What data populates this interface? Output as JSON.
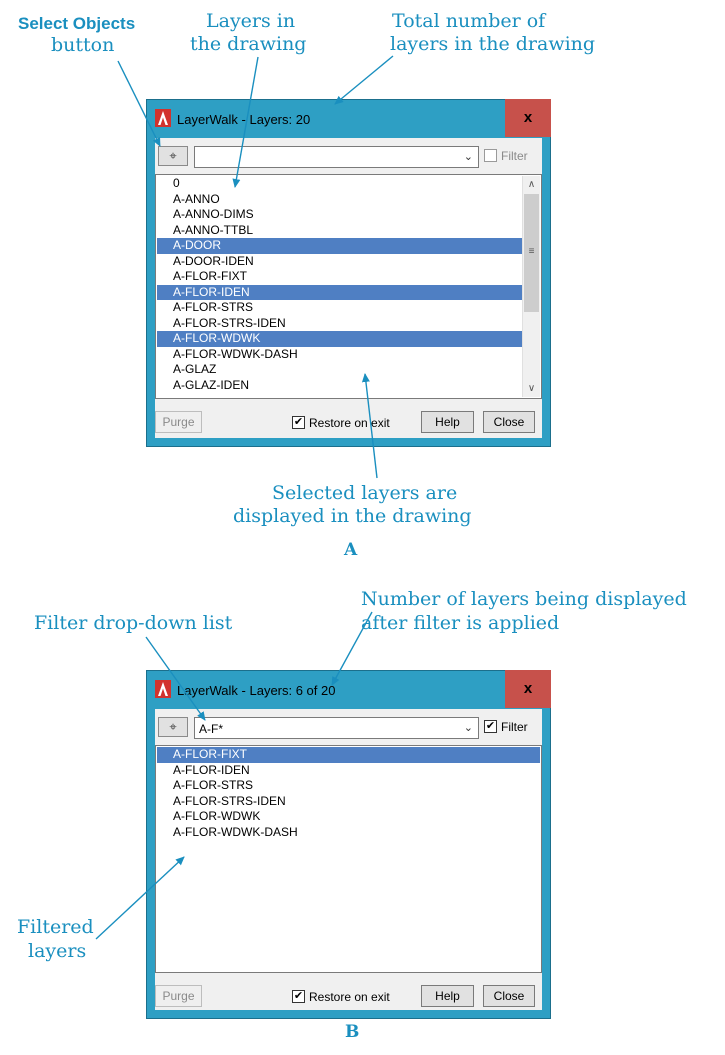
{
  "callouts": {
    "select_objects_1": "Select Objects",
    "select_objects_2": "button",
    "layers_in_1": "Layers in",
    "layers_in_2": "the drawing",
    "total_1": "Total number of",
    "total_2": "layers in the drawing",
    "selected_1": "Selected layers are",
    "selected_2": "displayed in the drawing",
    "fig_a": "A",
    "num_disp_1": "Number of layers being displayed",
    "num_disp_2": "after filter is applied",
    "filter_dd": "Filter drop-down list",
    "filtered_1": "Filtered",
    "filtered_2": "layers",
    "fig_b": "B"
  },
  "dialog_a": {
    "title": "LayerWalk - Layers: 20",
    "close_label": "x",
    "combo_value": "",
    "filter_label": "Filter",
    "filter_checked": false,
    "layers": [
      {
        "name": "0",
        "selected": false
      },
      {
        "name": "A-ANNO",
        "selected": false
      },
      {
        "name": "A-ANNO-DIMS",
        "selected": false
      },
      {
        "name": "A-ANNO-TTBL",
        "selected": false
      },
      {
        "name": "A-DOOR",
        "selected": true
      },
      {
        "name": "A-DOOR-IDEN",
        "selected": false
      },
      {
        "name": "A-FLOR-FIXT",
        "selected": false
      },
      {
        "name": "A-FLOR-IDEN",
        "selected": true
      },
      {
        "name": "A-FLOR-STRS",
        "selected": false
      },
      {
        "name": "A-FLOR-STRS-IDEN",
        "selected": false
      },
      {
        "name": "A-FLOR-WDWK",
        "selected": true
      },
      {
        "name": "A-FLOR-WDWK-DASH",
        "selected": false
      },
      {
        "name": "A-GLAZ",
        "selected": false
      },
      {
        "name": "A-GLAZ-IDEN",
        "selected": false
      }
    ],
    "purge_label": "Purge",
    "restore_label": "Restore on exit",
    "restore_checked": true,
    "help_label": "Help",
    "close_button_label": "Close"
  },
  "dialog_b": {
    "title": "LayerWalk - Layers: 6 of 20",
    "close_label": "x",
    "combo_value": "A-F*",
    "filter_label": "Filter",
    "filter_checked": true,
    "layers": [
      {
        "name": "A-FLOR-FIXT",
        "selected": true
      },
      {
        "name": "A-FLOR-IDEN",
        "selected": false
      },
      {
        "name": "A-FLOR-STRS",
        "selected": false
      },
      {
        "name": "A-FLOR-STRS-IDEN",
        "selected": false
      },
      {
        "name": "A-FLOR-WDWK",
        "selected": false
      },
      {
        "name": "A-FLOR-WDWK-DASH",
        "selected": false
      }
    ],
    "purge_label": "Purge",
    "restore_label": "Restore on exit",
    "restore_checked": true,
    "help_label": "Help",
    "close_button_label": "Close"
  },
  "colors": {
    "accent": "#1a8fbf",
    "window_frame": "#2e9fc4",
    "close_red": "#c7514b",
    "selection": "#4f7fc3"
  }
}
